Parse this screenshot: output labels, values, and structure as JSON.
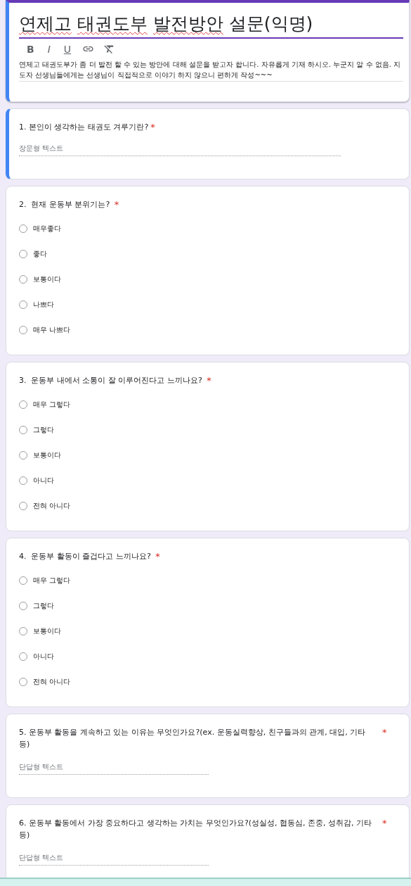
{
  "header": {
    "title_words": [
      {
        "text": "연제고",
        "misspelled": true
      },
      {
        "text": "태권도부",
        "misspelled": true
      },
      {
        "text": "발전방안",
        "misspelled": true
      },
      {
        "text": "설문(익명)",
        "misspelled": false
      }
    ],
    "toolbar": [
      {
        "kind": "bold",
        "label": "B"
      },
      {
        "kind": "italic",
        "label": "I"
      },
      {
        "kind": "underline",
        "label": "U"
      },
      {
        "kind": "link"
      },
      {
        "kind": "clear"
      }
    ],
    "description": "연제고 태권도부가 좀 더 발전 할 수 있는 방안에 대해 설문을 받고자 합니다. 자유롭게 기재 하시오. 누군지 알 수 없음. 지도자 선생님들에게는 선생님이 직접적으로 이야기 하지 않으니 편하게 작성~~~"
  },
  "questions": [
    {
      "kind": "long",
      "title": "1. 본인이 생각하는 태권도 겨루기란?",
      "required_mark": "*",
      "selected": true,
      "placeholder": "장문형 텍스트"
    },
    {
      "kind": "choice",
      "title": "2.  현재 운동부 분위기는? ",
      "required_mark": "*",
      "selected": false,
      "options": [
        {
          "label": "매우좋다",
          "checked": false
        },
        {
          "label": "좋다",
          "checked": false
        },
        {
          "label": "보통이다",
          "checked": false
        },
        {
          "label": "나쁘다",
          "checked": false
        },
        {
          "label": "매우 나쁘다",
          "checked": false
        }
      ]
    },
    {
      "kind": "choice",
      "title": "3.  운동부 내에서 소통이 잘 이루어진다고 느끼나요? ",
      "required_mark": "*",
      "selected": false,
      "options": [
        {
          "label": "매우 그렇다",
          "checked": false
        },
        {
          "label": "그렇다",
          "checked": false
        },
        {
          "label": "보통이다",
          "checked": false
        },
        {
          "label": "아니다",
          "checked": false
        },
        {
          "label": "전혀 아니다",
          "checked": false
        }
      ]
    },
    {
      "kind": "choice",
      "title": "4.  운동부 활동이 즐겁다고 느끼나요? ",
      "required_mark": "*",
      "selected": false,
      "options": [
        {
          "label": "매우 그렇다",
          "checked": false
        },
        {
          "label": "그렇다",
          "checked": false
        },
        {
          "label": "보통이다",
          "checked": false
        },
        {
          "label": "아니다",
          "checked": false
        },
        {
          "label": "전혀 아니다",
          "checked": false
        }
      ]
    },
    {
      "kind": "short",
      "title": "5. 운동부 활동을 계속하고 있는 이유는 무엇인가요?(ex. 운동실력향상, 친구들과의 관계, 대입, 기타 등)",
      "required_mark": "*",
      "selected": false,
      "placeholder": "단답형 텍스트"
    },
    {
      "kind": "short",
      "title": "6. 운동부 활동에서 가장 중요하다고 생각하는 가치는 무엇인가요?(성실성, 협동심, 존중, 성취감, 기타 등)",
      "required_mark": "*",
      "selected": false,
      "placeholder": "단답형 텍스트"
    }
  ]
}
